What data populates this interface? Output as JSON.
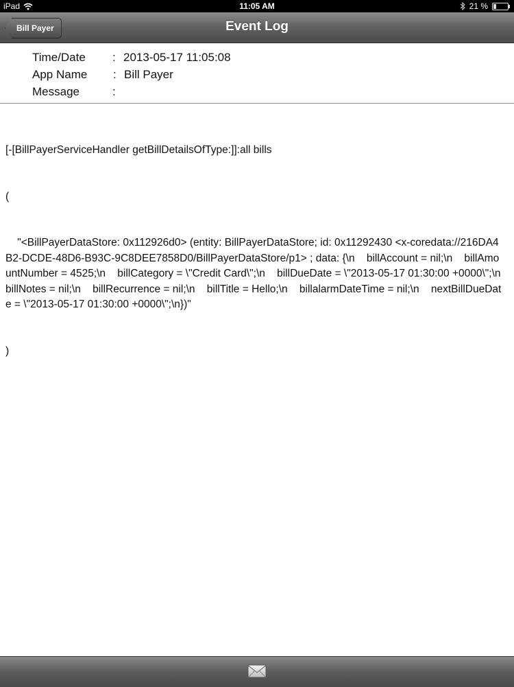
{
  "status_bar": {
    "device": "iPad",
    "time": "11:05 AM",
    "battery": "21 %",
    "battery_level": 0.21
  },
  "nav": {
    "back_label": "Bill Payer",
    "title": "Event Log"
  },
  "info": {
    "rows": [
      {
        "label": "Time/Date",
        "colon": ":",
        "value": "2013-05-17 11:05:08"
      },
      {
        "label": "App Name",
        "colon": ":",
        "value": "Bill Payer"
      },
      {
        "label": "Message",
        "colon": ":",
        "value": ""
      }
    ]
  },
  "message": {
    "lines": [
      "[-[BillPayerServiceHandler getBillDetailsOfType:]]:all bills",
      "(",
      "    \"<BillPayerDataStore: 0x112926d0> (entity: BillPayerDataStore; id: 0x11292430 <x-coredata://216DA4B2-DCDE-48D6-B93C-9C8DEE7858D0/BillPayerDataStore/p1> ; data: {\\n    billAccount = nil;\\n    billAmountNumber = 4525;\\n    billCategory = \\\"Credit Card\\\";\\n    billDueDate = \\\"2013-05-17 01:30:00 +0000\\\";\\n    billNotes = nil;\\n    billRecurrence = nil;\\n    billTitle = Hello;\\n    billalarmDateTime = nil;\\n    nextBillDueDate = \\\"2013-05-17 01:30:00 +0000\\\";\\n})\"",
      ")"
    ]
  },
  "toolbar": {
    "icon": "mail-icon"
  }
}
